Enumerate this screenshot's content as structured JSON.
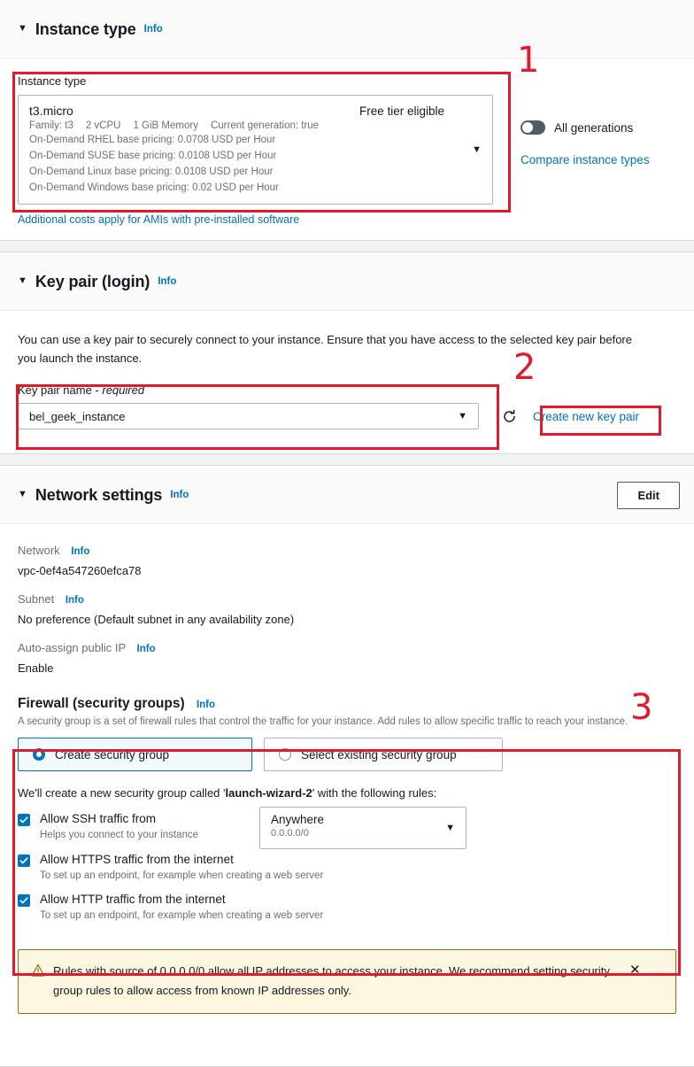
{
  "instance_type_section": {
    "title": "Instance type",
    "info_label": "Info",
    "caret": "▼",
    "field_label": "Instance type",
    "selected": {
      "name": "t3.micro",
      "free_tier": "Free tier eligible",
      "specs": [
        "Family: t3",
        "2 vCPU",
        "1 GiB Memory",
        "Current generation: true"
      ],
      "pricing": [
        "On-Demand RHEL base pricing: 0.0708 USD per Hour",
        "On-Demand SUSE base pricing: 0.0108 USD per Hour",
        "On-Demand Linux base pricing: 0.0108 USD per Hour",
        "On-Demand Windows base pricing: 0.02 USD per Hour"
      ]
    },
    "additional_costs_link": "Additional costs apply for AMIs with pre-installed software",
    "all_generations_toggle": {
      "label": "All generations",
      "state": "off"
    },
    "compare_link": "Compare instance types"
  },
  "key_pair_section": {
    "title": "Key pair (login)",
    "info_label": "Info",
    "caret": "▼",
    "description": "You can use a key pair to securely connect to your instance. Ensure that you have access to the selected key pair before you launch the instance.",
    "field_label_prefix": "Key pair name - ",
    "field_label_required": "required",
    "selected_key_pair": "bel_geek_instance",
    "refresh_icon": "refresh-icon",
    "create_link": "Create new key pair"
  },
  "network_settings_section": {
    "title": "Network settings",
    "info_label": "Info",
    "caret": "▼",
    "edit_button": "Edit",
    "fields": [
      {
        "label": "Network",
        "info": "Info",
        "value": "vpc-0ef4a547260efca78"
      },
      {
        "label": "Subnet",
        "info": "Info",
        "value": "No preference (Default subnet in any availability zone)"
      },
      {
        "label": "Auto-assign public IP",
        "info": "Info",
        "value": "Enable"
      }
    ],
    "firewall": {
      "title": "Firewall (security groups)",
      "info_label": "Info",
      "description": "A security group is a set of firewall rules that control the traffic for your instance. Add rules to allow specific traffic to reach your instance.",
      "options": [
        {
          "label": "Create security group",
          "selected": true
        },
        {
          "label": "Select existing security group",
          "selected": false
        }
      ],
      "note_prefix": "We'll create a new security group called '",
      "note_group_name": "launch-wizard-2",
      "note_suffix": "' with the following rules:",
      "rules": [
        {
          "label": "Allow SSH traffic from",
          "sub": "Helps you connect to your instance",
          "checked": true,
          "source_main": "Anywhere",
          "source_sub": "0.0.0.0/0"
        },
        {
          "label": "Allow HTTPS traffic from the internet",
          "sub": "To set up an endpoint, for example when creating a web server",
          "checked": true
        },
        {
          "label": "Allow HTTP traffic from the internet",
          "sub": "To set up an endpoint, for example when creating a web server",
          "checked": true
        }
      ]
    }
  },
  "alert": {
    "icon": "warning-triangle-icon",
    "message": "Rules with source of 0.0.0.0/0 allow all IP addresses to access your instance. We recommend setting security group rules to allow access from known IP addresses only.",
    "close_label": "✕"
  },
  "annotations": {
    "colors": {
      "highlight": "#e3192c"
    },
    "numbers": [
      "1",
      "2",
      "3"
    ]
  }
}
